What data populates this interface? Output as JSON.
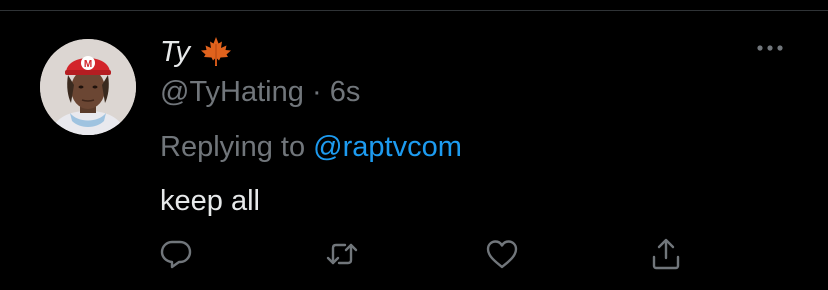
{
  "tweet": {
    "author": {
      "display_name": "Ty",
      "handle": "@TyHating",
      "separator": "·",
      "timestamp": "6s",
      "name_emoji": "maple-leaf-icon",
      "avatar": "user-avatar"
    },
    "replying_to": {
      "label": "Replying to",
      "mention": "@raptvcom"
    },
    "text": "keep all",
    "menu_icon": "more-icon",
    "actions": [
      {
        "name": "reply",
        "icon": "reply-icon"
      },
      {
        "name": "retweet",
        "icon": "retweet-icon"
      },
      {
        "name": "like",
        "icon": "heart-icon"
      },
      {
        "name": "share",
        "icon": "share-icon"
      }
    ]
  },
  "colors": {
    "background": "#000000",
    "primary_text": "#e7e9ea",
    "secondary_text": "#71767b",
    "link": "#1d9bf0",
    "divider": "#2f3336"
  }
}
